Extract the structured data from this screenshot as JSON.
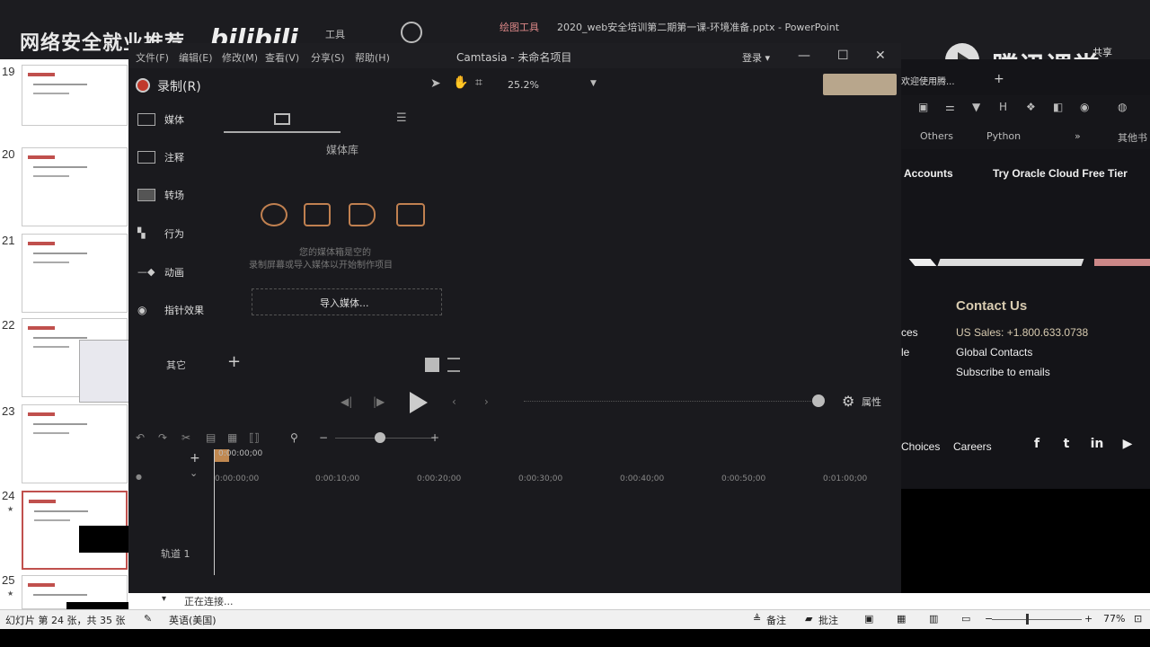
{
  "powerpoint": {
    "title": "2020_web安全培训第二期第一课-环境准备.pptx - PowerPoint",
    "draw_tools": "绘图工具",
    "tool_menu": "工具",
    "share": "共享",
    "slides": [
      {
        "num": "19"
      },
      {
        "num": "20"
      },
      {
        "num": "21"
      },
      {
        "num": "22"
      },
      {
        "num": "23"
      },
      {
        "num": "24"
      },
      {
        "num": "25"
      }
    ],
    "notes_status": "正在连接...",
    "status": {
      "slide_info": "幻灯片 第 24 张，共 35 张",
      "language": "英语(美国)",
      "notes": "备注",
      "comments": "批注",
      "zoom": "77%"
    }
  },
  "watermarks": {
    "left": "网络安全就业推荐",
    "bili": "bilibili",
    "right": "腾讯课堂"
  },
  "camtasia": {
    "menus": [
      "文件(F)",
      "编辑(E)",
      "修改(M)",
      "查看(V)",
      "分享(S)",
      "帮助(H)"
    ],
    "title": "Camtasia - 未命名项目",
    "login": "登录 ▾",
    "record": "录制(R)",
    "zoom": "25.2%",
    "sidebar": [
      "媒体",
      "注释",
      "转场",
      "行为",
      "动画",
      "指针效果"
    ],
    "other": "其它",
    "library_title": "媒体库",
    "hint1": "您的媒体箱是空的",
    "hint2": "录制屏幕或导入媒体以开始制作项目",
    "import": "导入媒体...",
    "properties": "属性",
    "playhead_time": "0:00:00;00",
    "ticks": [
      "0:00:00;00",
      "0:00:10;00",
      "0:00:20;00",
      "0:00:30;00",
      "0:00:40;00",
      "0:00:50;00",
      "0:01:00;00"
    ],
    "track": "轨道 1"
  },
  "browser": {
    "tab": "欢迎使用腾...",
    "bookmarks": [
      "Others",
      "Python",
      "其他书"
    ],
    "nav": [
      "Accounts",
      "Try Oracle Cloud Free Tier"
    ],
    "contact_title": "Contact Us",
    "contacts": [
      "US Sales: +1.800.633.0738",
      "Global Contacts",
      "Subscribe to emails"
    ],
    "left_frags": [
      "ces",
      "le"
    ],
    "footer": [
      "Choices",
      "Careers"
    ],
    "social": [
      "f",
      "t",
      "in",
      "▶"
    ]
  }
}
